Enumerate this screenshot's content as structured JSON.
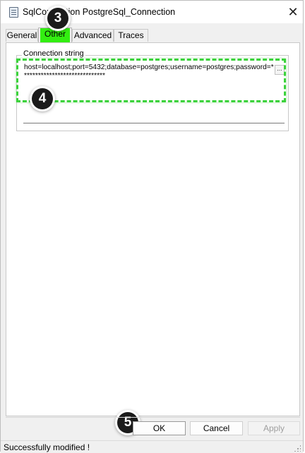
{
  "window": {
    "title": "SqlConnection PostgreSql_Connection",
    "close_glyph": "✕"
  },
  "tabs": [
    {
      "label": "General",
      "active": false
    },
    {
      "label": "Other",
      "active": true
    },
    {
      "label": "Advanced",
      "active": false
    },
    {
      "label": "Traces",
      "active": false
    }
  ],
  "other": {
    "group_label": "Connection string",
    "connection_string": "host=localhost;port=5432;database=postgres;username=postgres;password=******************************",
    "browse_label": "..."
  },
  "annotations": {
    "step_tabs": "3",
    "step_connection": "4",
    "step_ok": "5",
    "highlight_color": "#3ad23a",
    "flag_color": "#33ee11"
  },
  "buttons": {
    "ok": "OK",
    "cancel": "Cancel",
    "apply": "Apply"
  },
  "status": {
    "message": "Successfully modified !"
  }
}
